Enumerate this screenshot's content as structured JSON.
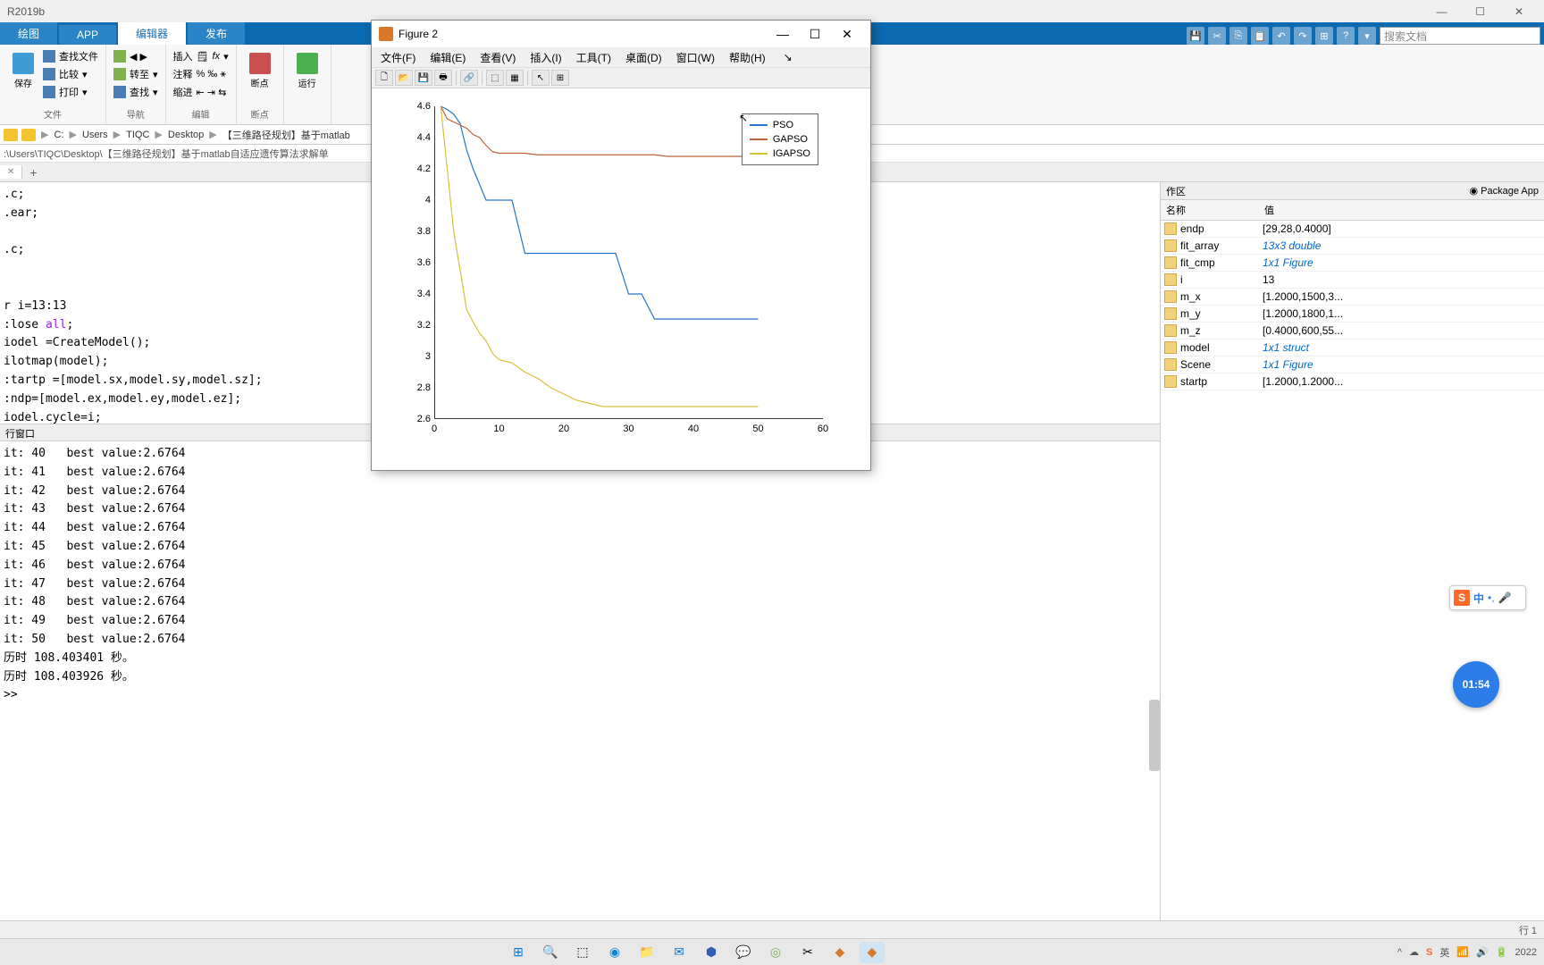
{
  "app_title": "R2019b",
  "tabs": {
    "plot": "绘图",
    "app": "APP",
    "editor": "编辑器",
    "publish": "发布"
  },
  "search_placeholder": "搜索文档",
  "ribbon": {
    "file_group": "文件",
    "save": "保存",
    "find_files": "查找文件",
    "compare": "比较",
    "print": "打印",
    "nav_group": "导航",
    "goto": "转至",
    "find": "查找",
    "edit_group": "编辑",
    "insert": "插入",
    "comment": "注释",
    "indent": "缩进",
    "breakpoints": "断点",
    "run": "运行"
  },
  "breadcrumb": [
    "C:",
    "Users",
    "TIQC",
    "Desktop",
    "【三维路径规划】基于matlab"
  ],
  "filepath": ":\\Users\\TIQC\\Desktop\\【三维路径规划】基于matlab自适应遗传算法求解单",
  "editor_plus": "+",
  "code_lines": [
    ".c;",
    ".ear;",
    "",
    ".c;",
    "",
    "",
    "r i=13:13",
    ":lose all;",
    "iodel =CreateModel();",
    "ilotmap(model);",
    ":tartp =[model.sx,model.sy,model.sz];",
    ":ndp=[model.ex,model.ey,model.ez];",
    "iodel.cycle=i;"
  ],
  "cmdwin_label": "行窗口",
  "console_lines": [
    "it: 40   best value:2.6764",
    "it: 41   best value:2.6764",
    "it: 42   best value:2.6764",
    "it: 43   best value:2.6764",
    "it: 44   best value:2.6764",
    "it: 45   best value:2.6764",
    "it: 46   best value:2.6764",
    "it: 47   best value:2.6764",
    "it: 48   best value:2.6764",
    "it: 49   best value:2.6764",
    "it: 50   best value:2.6764",
    "历时 108.403401 秒。",
    "历时 108.403926 秒。",
    ">>"
  ],
  "workspace": {
    "label": "作区",
    "pkg": "Package App",
    "cols": {
      "name": "名称",
      "value": "值"
    },
    "rows": [
      {
        "name": "endp",
        "value": "[29,28,0.4000]",
        "obj": false
      },
      {
        "name": "fit_array",
        "value": "13x3 double",
        "obj": true
      },
      {
        "name": "fit_cmp",
        "value": "1x1 Figure",
        "obj": true
      },
      {
        "name": "i",
        "value": "13",
        "obj": false
      },
      {
        "name": "m_x",
        "value": "[1.2000,1500,3...",
        "obj": false
      },
      {
        "name": "m_y",
        "value": "[1.2000,1800,1...",
        "obj": false
      },
      {
        "name": "m_z",
        "value": "[0.4000,600,55...",
        "obj": false
      },
      {
        "name": "model",
        "value": "1x1 struct",
        "obj": true
      },
      {
        "name": "Scene",
        "value": "1x1 Figure",
        "obj": true
      },
      {
        "name": "startp",
        "value": "[1.2000,1.2000...",
        "obj": false
      }
    ]
  },
  "figure": {
    "title": "Figure 2",
    "menu": [
      "文件(F)",
      "编辑(E)",
      "查看(V)",
      "插入(I)",
      "工具(T)",
      "桌面(D)",
      "窗口(W)",
      "帮助(H)"
    ],
    "legend": [
      "PSO",
      "GAPSO",
      "IGAPSO"
    ],
    "yticks": [
      "4.6",
      "4.4",
      "4.2",
      "4",
      "3.8",
      "3.6",
      "3.4",
      "3.2",
      "3",
      "2.8",
      "2.6"
    ],
    "xticks": [
      "0",
      "10",
      "20",
      "30",
      "40",
      "50",
      "60"
    ]
  },
  "chart_data": {
    "type": "line",
    "xlabel": "",
    "ylabel": "",
    "xlim": [
      0,
      60
    ],
    "ylim": [
      2.6,
      4.6
    ],
    "x": [
      1,
      2,
      3,
      4,
      5,
      6,
      7,
      8,
      9,
      10,
      12,
      14,
      16,
      18,
      20,
      22,
      24,
      26,
      28,
      30,
      32,
      34,
      36,
      38,
      40,
      42,
      44,
      46,
      48,
      50
    ],
    "series": [
      {
        "name": "PSO",
        "color": "#2874c7",
        "values": [
          4.6,
          4.58,
          4.55,
          4.49,
          4.32,
          4.2,
          4.1,
          4.0,
          4.0,
          4.0,
          4.0,
          3.66,
          3.66,
          3.66,
          3.66,
          3.66,
          3.66,
          3.66,
          3.66,
          3.4,
          3.4,
          3.24,
          3.24,
          3.24,
          3.24,
          3.24,
          3.24,
          3.24,
          3.24,
          3.24
        ]
      },
      {
        "name": "GAPSO",
        "color": "#b96437",
        "values": [
          4.6,
          4.52,
          4.5,
          4.48,
          4.46,
          4.42,
          4.4,
          4.35,
          4.31,
          4.3,
          4.3,
          4.3,
          4.29,
          4.29,
          4.29,
          4.29,
          4.29,
          4.29,
          4.29,
          4.29,
          4.29,
          4.29,
          4.28,
          4.28,
          4.28,
          4.28,
          4.28,
          4.28,
          4.28,
          4.28
        ]
      },
      {
        "name": "IGAPSO",
        "color": "#d4c23a",
        "values": [
          4.6,
          4.2,
          3.8,
          3.55,
          3.3,
          3.22,
          3.15,
          3.1,
          3.02,
          2.98,
          2.96,
          2.9,
          2.86,
          2.8,
          2.76,
          2.72,
          2.7,
          2.68,
          2.68,
          2.68,
          2.68,
          2.68,
          2.68,
          2.68,
          2.68,
          2.68,
          2.68,
          2.68,
          2.68,
          2.68
        ]
      }
    ]
  },
  "ime": {
    "label": "中"
  },
  "timer": "01:54",
  "status": "行 1",
  "sys_date": "2022"
}
